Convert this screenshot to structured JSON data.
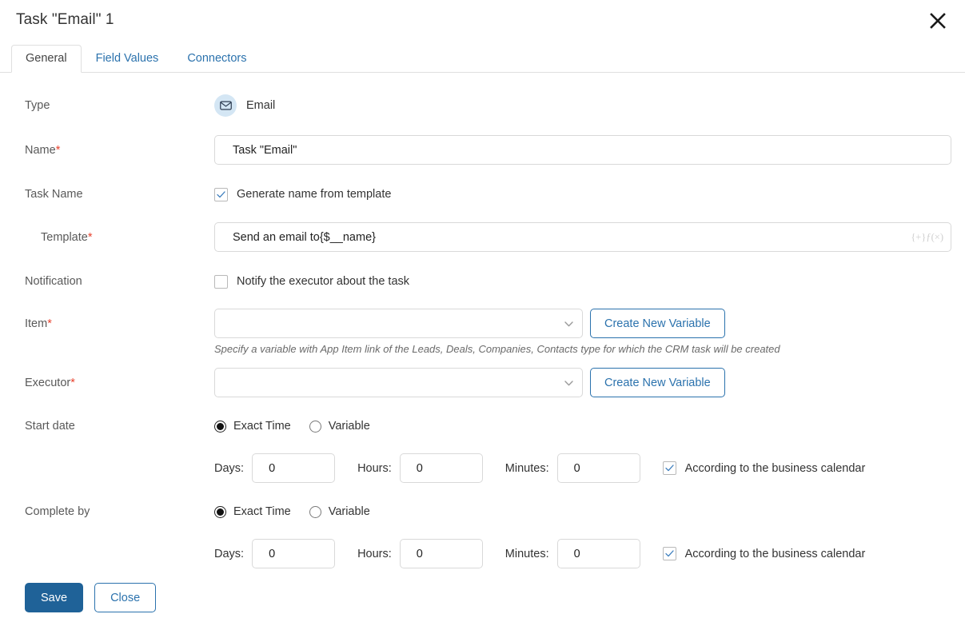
{
  "dialog": {
    "title": "Task \"Email\" 1",
    "close_icon": "close-icon"
  },
  "tabs": [
    {
      "label": "General",
      "active": true
    },
    {
      "label": "Field Values",
      "active": false
    },
    {
      "label": "Connectors",
      "active": false
    }
  ],
  "form": {
    "type": {
      "label": "Type",
      "icon": "envelope-icon",
      "value": "Email",
      "icon_bg": "#d4e6f4"
    },
    "name": {
      "label": "Name",
      "required": "*",
      "value": "Task \"Email\""
    },
    "task_name": {
      "label": "Task Name",
      "checkbox_label": "Generate name from template",
      "checked": true
    },
    "template": {
      "label": "Template",
      "required": "*",
      "value": "Send an email to{$__name}",
      "adornment": "{+}ƒ(×)"
    },
    "notification": {
      "label": "Notification",
      "checkbox_label": "Notify the executor about the task",
      "checked": false
    },
    "item": {
      "label": "Item",
      "required": "*",
      "value": "",
      "button_label": "Create New Variable",
      "hint": "Specify a variable with App Item link of the Leads, Deals, Companies, Contacts type for which the CRM task will be created"
    },
    "executor": {
      "label": "Executor",
      "required": "*",
      "value": "",
      "button_label": "Create New Variable"
    },
    "start_date": {
      "label": "Start date",
      "mode_options": [
        "Exact Time",
        "Variable"
      ],
      "selected_mode": "Exact Time",
      "days_label": "Days:",
      "days_value": "0",
      "hours_label": "Hours:",
      "hours_value": "0",
      "minutes_label": "Minutes:",
      "minutes_value": "0",
      "calendar_label": "According to the business calendar",
      "calendar_checked": true
    },
    "complete_by": {
      "label": "Complete by",
      "mode_options": [
        "Exact Time",
        "Variable"
      ],
      "selected_mode": "Exact Time",
      "days_label": "Days:",
      "days_value": "0",
      "hours_label": "Hours:",
      "hours_value": "0",
      "minutes_label": "Minutes:",
      "minutes_value": "0",
      "calendar_label": "According to the business calendar",
      "calendar_checked": true
    }
  },
  "footer": {
    "save_label": "Save",
    "close_label": "Close"
  },
  "colors": {
    "accent": "#2b72ad",
    "primary_button": "#1f6298",
    "required_star": "#e8432f",
    "label_text": "#595959"
  }
}
